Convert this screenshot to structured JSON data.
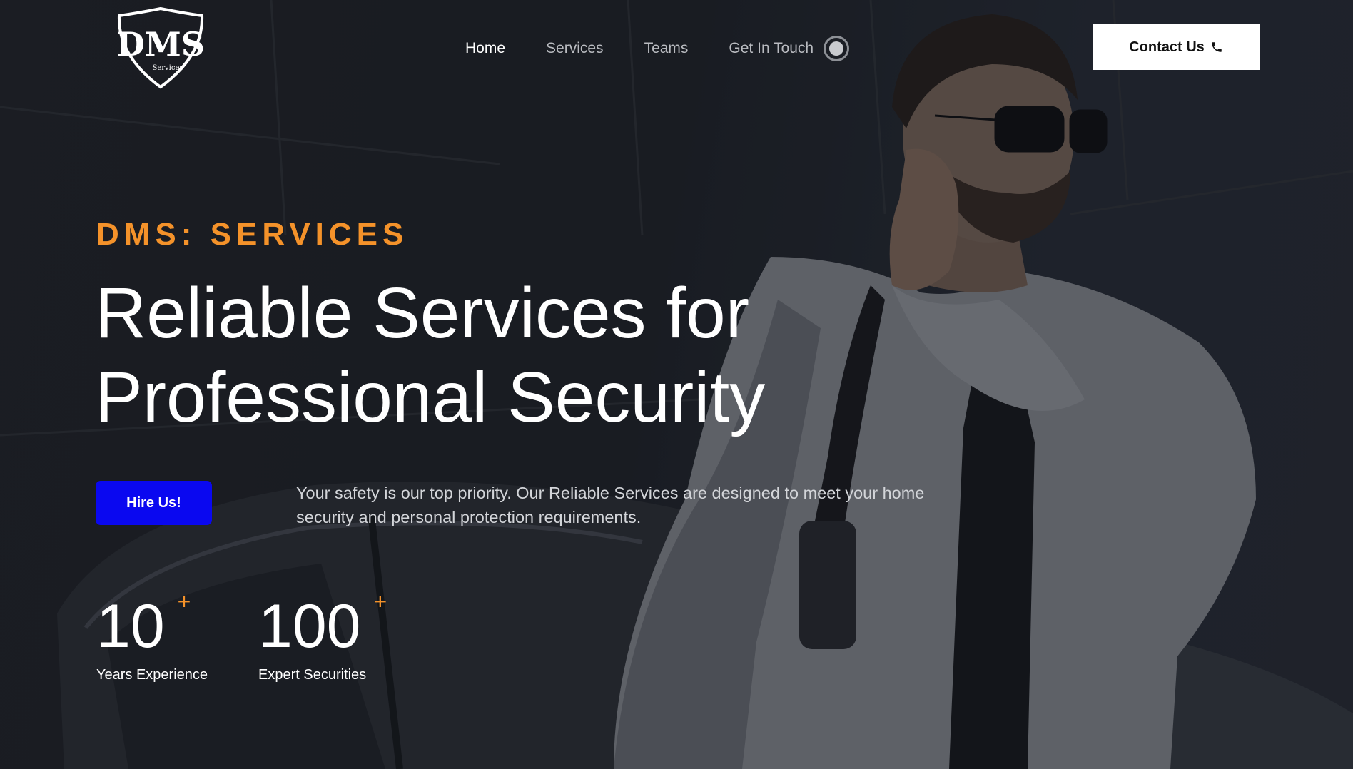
{
  "brand": {
    "logo_text": "DMS",
    "logo_subtext": "Services"
  },
  "nav": {
    "items": [
      {
        "label": "Home",
        "active": true
      },
      {
        "label": "Services",
        "active": false
      },
      {
        "label": "Teams",
        "active": false
      },
      {
        "label": "Get In Touch",
        "active": false
      }
    ],
    "theme_toggle_icon": "toggle-icon"
  },
  "header": {
    "contact_label": "Contact Us",
    "contact_icon": "phone-icon"
  },
  "hero": {
    "eyebrow": "DMS: SERVICES",
    "headline_line1": "Reliable Services for",
    "headline_line2": "Professional Security",
    "cta_label": "Hire Us!",
    "description": "Your safety is our top priority. Our Reliable Services are designed to meet your home security and personal protection requirements."
  },
  "stats": [
    {
      "value": "10",
      "suffix": "+",
      "label": "Years Experience"
    },
    {
      "value": "100",
      "suffix": "+",
      "label": "Expert Securities"
    }
  ],
  "colors": {
    "accent": "#f4922a",
    "cta": "#0a08f0",
    "background": "#22252b",
    "text": "#ffffff"
  }
}
